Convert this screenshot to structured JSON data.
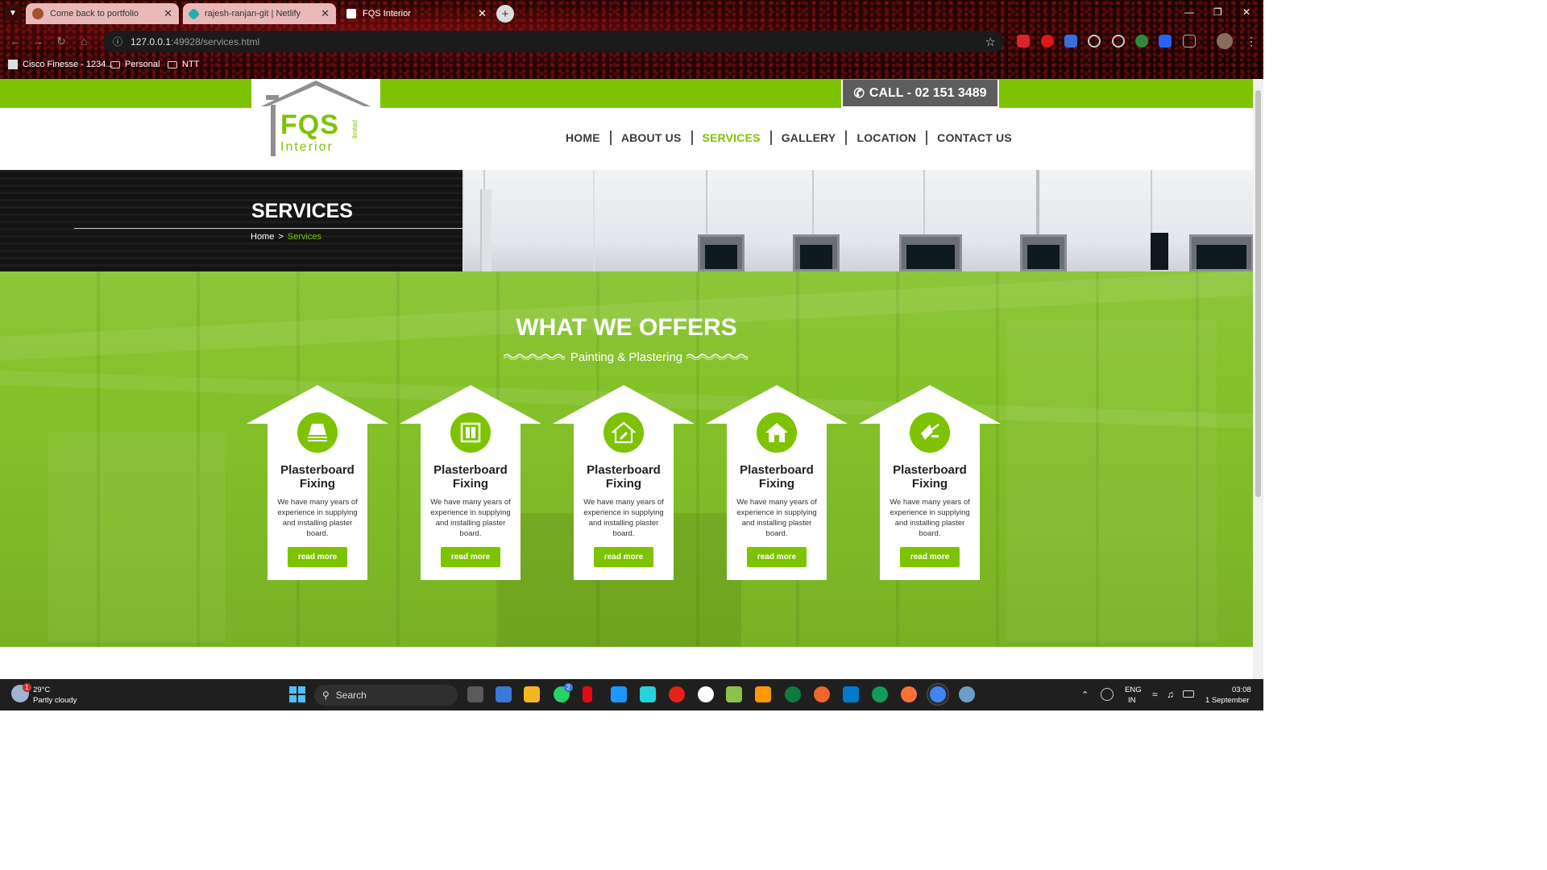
{
  "browser": {
    "tabs": [
      {
        "title": "Come back to portfolio",
        "active": false
      },
      {
        "title": "rajesh-ranjan-git | Netlify",
        "active": false
      },
      {
        "title": "FQS Interior",
        "active": true
      }
    ],
    "url_host": "127.0.0.1",
    "url_rest": ":49928/services.html",
    "bookmarks": [
      "Cisco Finesse - 1234...",
      "Personal",
      "NTT"
    ]
  },
  "site": {
    "logo": {
      "word": "FQS",
      "sub": "Interior",
      "tag": "limited"
    },
    "call": "CALL - 02 151 3489",
    "nav": [
      {
        "label": "HOME",
        "active": false
      },
      {
        "label": "ABOUT US",
        "active": false
      },
      {
        "label": "SERVICES",
        "active": true
      },
      {
        "label": "GALLERY",
        "active": false
      },
      {
        "label": "LOCATION",
        "active": false
      },
      {
        "label": "CONTACT US",
        "active": false
      }
    ],
    "banner": {
      "title": "SERVICES",
      "crumb_home": "Home",
      "crumb_sep": ">",
      "crumb_current": "Services"
    },
    "offers": {
      "title": "WHAT WE OFFERS",
      "subtitle": "Painting & Plastering",
      "cards": [
        {
          "icon": "plasterboard-stack-icon",
          "title": "Plasterboard Fixing",
          "desc": "We have many years of experience in supplying and installing plaster board.",
          "button": "read more"
        },
        {
          "icon": "door-panel-icon",
          "title": "Plasterboard Fixing",
          "desc": "We have many years of experience in supplying and installing plaster board.",
          "button": "read more"
        },
        {
          "icon": "house-paint-icon",
          "title": "Plasterboard Fixing",
          "desc": "We have many years of experience in supplying and installing plaster board.",
          "button": "read more"
        },
        {
          "icon": "house-icon",
          "title": "Plasterboard Fixing",
          "desc": "We have many years of experience in supplying and installing plaster board.",
          "button": "read more"
        },
        {
          "icon": "trowel-icon",
          "title": "Plasterboard Fixing",
          "desc": "We have many years of experience in supplying and installing plaster board.",
          "button": "read more"
        }
      ]
    }
  },
  "taskbar": {
    "weather_temp": "29°C",
    "weather_desc": "Partly cloudy",
    "weather_badge": "1",
    "search_label": "Search",
    "whatsapp_badge": "2",
    "lang_top": "ENG",
    "lang_bottom": "IN",
    "time": "03:08",
    "date": "1 September"
  },
  "colors": {
    "brand_green": "#7dc301",
    "call_grey": "#5d5d5d"
  }
}
